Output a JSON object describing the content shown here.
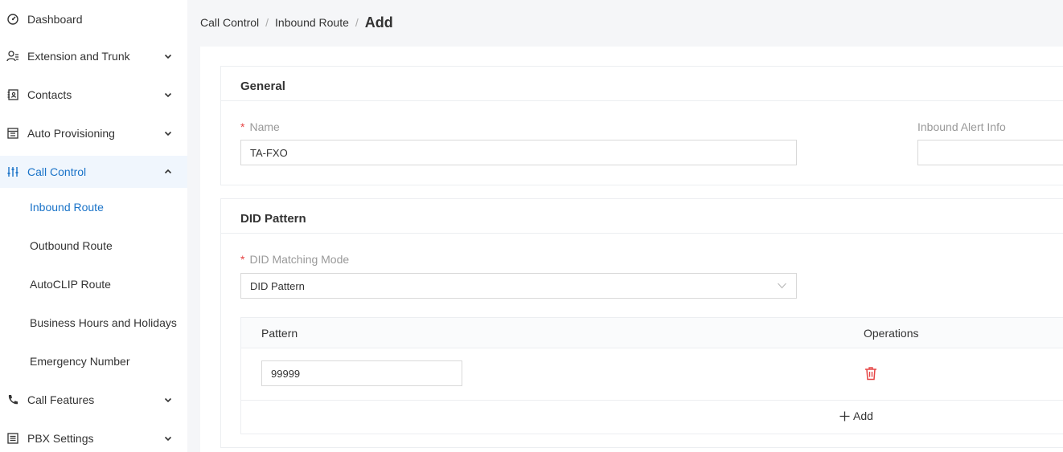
{
  "sidebar": {
    "items": [
      {
        "label": "Dashboard",
        "icon": "dashboard-icon"
      },
      {
        "label": "Extension and Trunk",
        "icon": "users-icon"
      },
      {
        "label": "Contacts",
        "icon": "contacts-icon"
      },
      {
        "label": "Auto Provisioning",
        "icon": "provisioning-icon"
      },
      {
        "label": "Call Control",
        "icon": "sliders-icon"
      },
      {
        "label": "Call Features",
        "icon": "phone-icon"
      },
      {
        "label": "PBX Settings",
        "icon": "settings-list-icon"
      }
    ],
    "sub_items": [
      {
        "label": "Inbound Route"
      },
      {
        "label": "Outbound Route"
      },
      {
        "label": "AutoCLIP Route"
      },
      {
        "label": "Business Hours and Holidays"
      },
      {
        "label": "Emergency Number"
      }
    ]
  },
  "breadcrumb": {
    "level1": "Call Control",
    "level2": "Inbound Route",
    "current": "Add",
    "separator": "/"
  },
  "general": {
    "title": "General",
    "name_label": "Name",
    "name_value": "TA-FXO",
    "alert_label": "Inbound Alert Info",
    "alert_value": ""
  },
  "did": {
    "title": "DID Pattern",
    "mode_label": "DID Matching Mode",
    "mode_value": "DID Pattern",
    "table": {
      "col_pattern": "Pattern",
      "col_operations": "Operations",
      "rows": [
        {
          "pattern": "99999"
        }
      ],
      "add_label": "Add"
    }
  },
  "colors": {
    "accent": "#1a73c8",
    "active_bg": "#f0f6fd",
    "required": "#e64545",
    "delete": "#e64545"
  }
}
